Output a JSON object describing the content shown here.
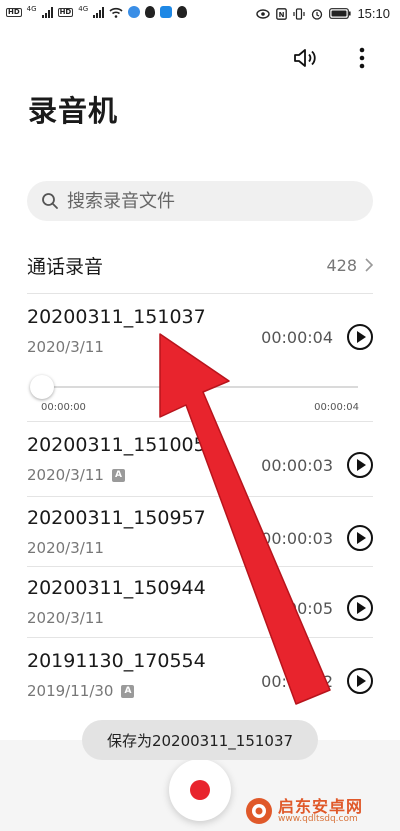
{
  "status_bar": {
    "hd1": "HD",
    "hd2": "HD",
    "net1": "4G",
    "net2": "4G",
    "time": "15:10"
  },
  "app": {
    "title": "录音机"
  },
  "search": {
    "placeholder": "搜索录音文件"
  },
  "call_recordings": {
    "label": "通话录音",
    "count": "428"
  },
  "recordings": [
    {
      "name": "20200311_151037",
      "date": "2020/3/11",
      "duration": "00:00:04",
      "badge": ""
    },
    {
      "name": "20200311_151005",
      "date": "2020/3/11",
      "duration": "00:00:03",
      "badge": "A"
    },
    {
      "name": "20200311_150957",
      "date": "2020/3/11",
      "duration": "00:00:03",
      "badge": ""
    },
    {
      "name": "20200311_150944",
      "date": "2020/3/11",
      "duration": "00:00:05",
      "badge": ""
    },
    {
      "name": "20191130_170554",
      "date": "2019/11/30",
      "duration": "00:00:12",
      "badge": "A"
    }
  ],
  "player": {
    "elapsed": "00:00:00",
    "total": "00:00:04",
    "progress": 0
  },
  "toast": {
    "text": "保存为20200311_151037"
  },
  "watermark": {
    "cn": "启东安卓网",
    "url": "www.qdltsdq.com"
  },
  "colors": {
    "record_red": "#e8242d",
    "arrow_red": "#e8242d",
    "watermark": "#e0592a"
  }
}
